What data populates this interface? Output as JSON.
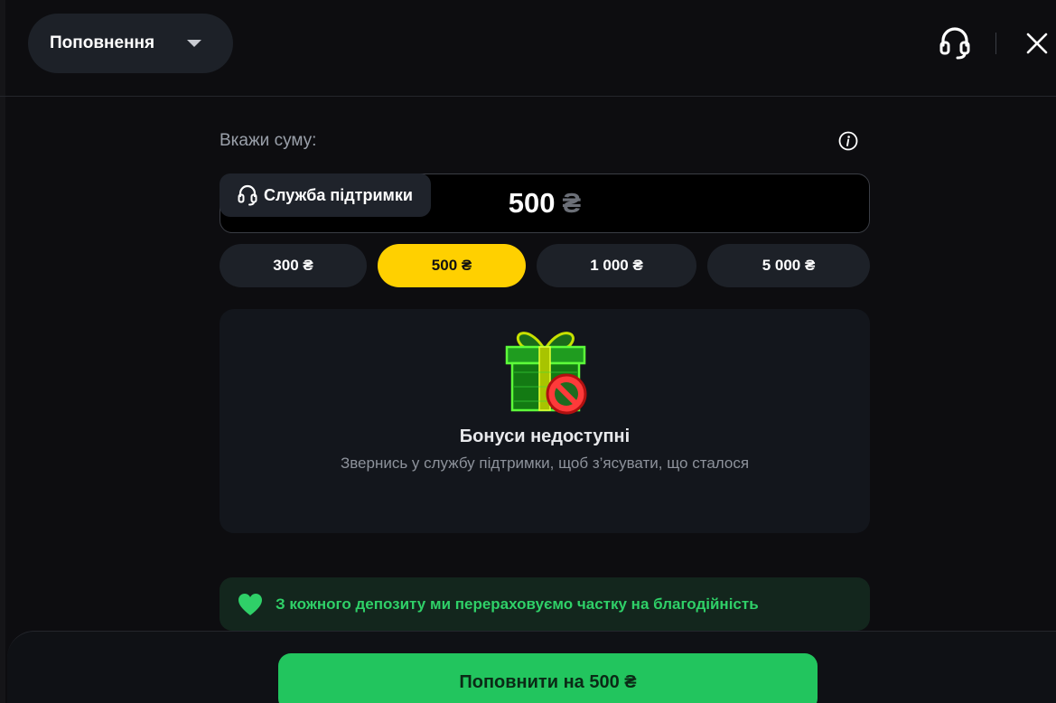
{
  "header": {
    "method_label": "Поповнення"
  },
  "amount": {
    "label": "Вкажи суму:",
    "value": "500",
    "currency": "₴"
  },
  "presets": [
    {
      "label": "300 ₴",
      "active": false
    },
    {
      "label": "500 ₴",
      "active": true
    },
    {
      "label": "1 000 ₴",
      "active": false
    },
    {
      "label": "5 000 ₴",
      "active": false
    }
  ],
  "bonus": {
    "title": "Бонуси недоступні",
    "subtitle": "Звернись у службу підтримки, щоб з’ясувати, що сталося",
    "support_label": "Служба підтримки"
  },
  "charity": {
    "text": "З кожного депозиту ми перераховуємо частку на благодійність"
  },
  "footer": {
    "deposit_label": "Поповнити на 500 ₴"
  },
  "colors": {
    "accent_yellow": "#ffd000",
    "accent_green": "#22c55e",
    "charity_green": "#2fd068"
  },
  "icons": [
    "chevron-down-icon",
    "headset-icon",
    "close-icon",
    "info-icon",
    "gift-icon",
    "heart-icon"
  ]
}
